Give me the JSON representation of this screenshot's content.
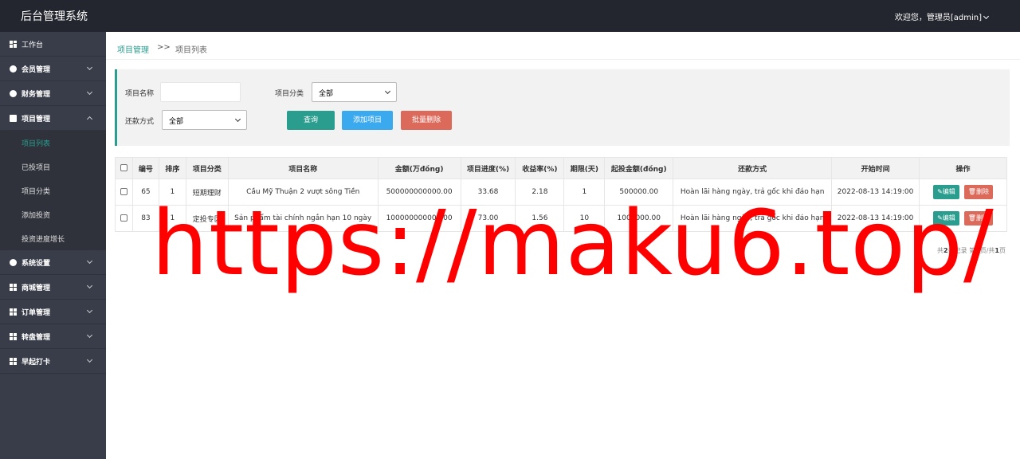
{
  "topbar": {
    "title": "后台管理系统",
    "welcome": "欢迎您，管理员[admin]"
  },
  "sidebar": {
    "items": [
      {
        "label": "工作台",
        "icon": "dashboard-icon"
      },
      {
        "label": "会员管理",
        "icon": "member-icon"
      },
      {
        "label": "财务管理",
        "icon": "yen-icon"
      },
      {
        "label": "项目管理",
        "icon": "document-icon",
        "expanded": true,
        "children": [
          "项目列表",
          "已投项目",
          "项目分类",
          "添加投资",
          "投资进度增长"
        ]
      },
      {
        "label": "系统设置",
        "icon": "gear-icon"
      },
      {
        "label": "商城管理",
        "icon": "grid-icon"
      },
      {
        "label": "订单管理",
        "icon": "grid-icon"
      },
      {
        "label": "转盘管理",
        "icon": "grid-icon"
      },
      {
        "label": "早起打卡",
        "icon": "grid-icon"
      }
    ]
  },
  "breadcrumb": {
    "parent": "项目管理",
    "separator": ">>",
    "current": "项目列表"
  },
  "search": {
    "name_label": "项目名称",
    "name_value": "",
    "category_label": "项目分类",
    "category_value": "全部",
    "repay_label": "还款方式",
    "repay_value": "全部",
    "query_btn": "查询",
    "add_btn": "添加项目",
    "batch_delete_btn": "批量删除"
  },
  "table": {
    "headers": [
      "编号",
      "排序",
      "项目分类",
      "项目名称",
      "金额(万đồng)",
      "项目进度(%)",
      "收益率(%)",
      "期限(天)",
      "起投金额(đồng)",
      "还款方式",
      "开始时间",
      "操作"
    ],
    "rows": [
      [
        "65",
        "1",
        "短期理财",
        "Cầu Mỹ Thuận 2 vượt sông Tiền",
        "500000000000.00",
        "33.68",
        "2.18",
        "1",
        "500000.00",
        "Hoàn lãi hàng ngày, trả gốc khi đáo hạn",
        "2022-08-13 14:19:00"
      ],
      [
        "83",
        "1",
        "定投专区",
        "Sản phẩm tài chính ngắn hạn 10 ngày",
        "100000000000.00",
        "73.00",
        "1.56",
        "10",
        "1000000.00",
        "Hoàn lãi hàng ngày, trả gốc khi đáo hạn",
        "2022-08-13 14:19:00"
      ]
    ],
    "edit_label": "编辑",
    "delete_label": "删除"
  },
  "pager": {
    "p1": "共",
    "total": "2",
    "p2": "条记录 第",
    "page": "1",
    "p3": "页/共",
    "pages": "1",
    "p4": "页"
  },
  "watermark": "https://maku6.top/",
  "colors": {
    "topbar": "#23262e",
    "sidebar": "#393d49",
    "accent": "#2a9d8f",
    "blue": "#3ba9ee",
    "danger": "#dc6a5b",
    "watermark": "#ff0000"
  }
}
